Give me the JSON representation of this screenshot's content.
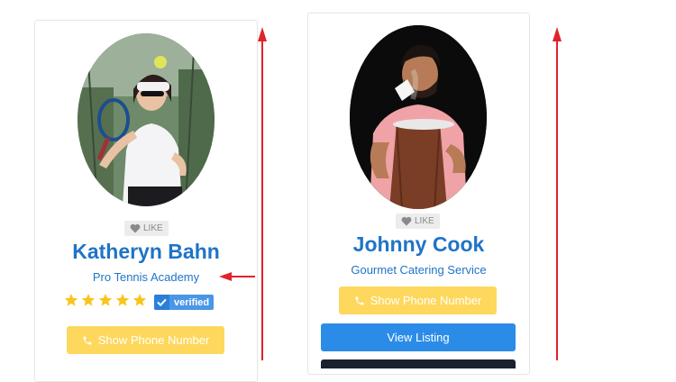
{
  "cards": [
    {
      "like_label": "LIKE",
      "name": "Katheryn Bahn",
      "business": "Pro Tennis Academy",
      "rating": 5,
      "verified_label": "verified",
      "phone_button": "Show Phone Number"
    },
    {
      "like_label": "LIKE",
      "name": "Johnny Cook",
      "business": "Gourmet Catering Service",
      "phone_button": "Show Phone Number",
      "listing_button": "View Listing"
    }
  ],
  "colors": {
    "accent_blue": "#1f74c7",
    "phone_button_yellow": "#fdd85c",
    "listing_button_blue": "#2b8ce8",
    "verified_blue": "#4a96e6",
    "star_yellow": "#f7c51e",
    "annotation_red": "#e0232b"
  }
}
